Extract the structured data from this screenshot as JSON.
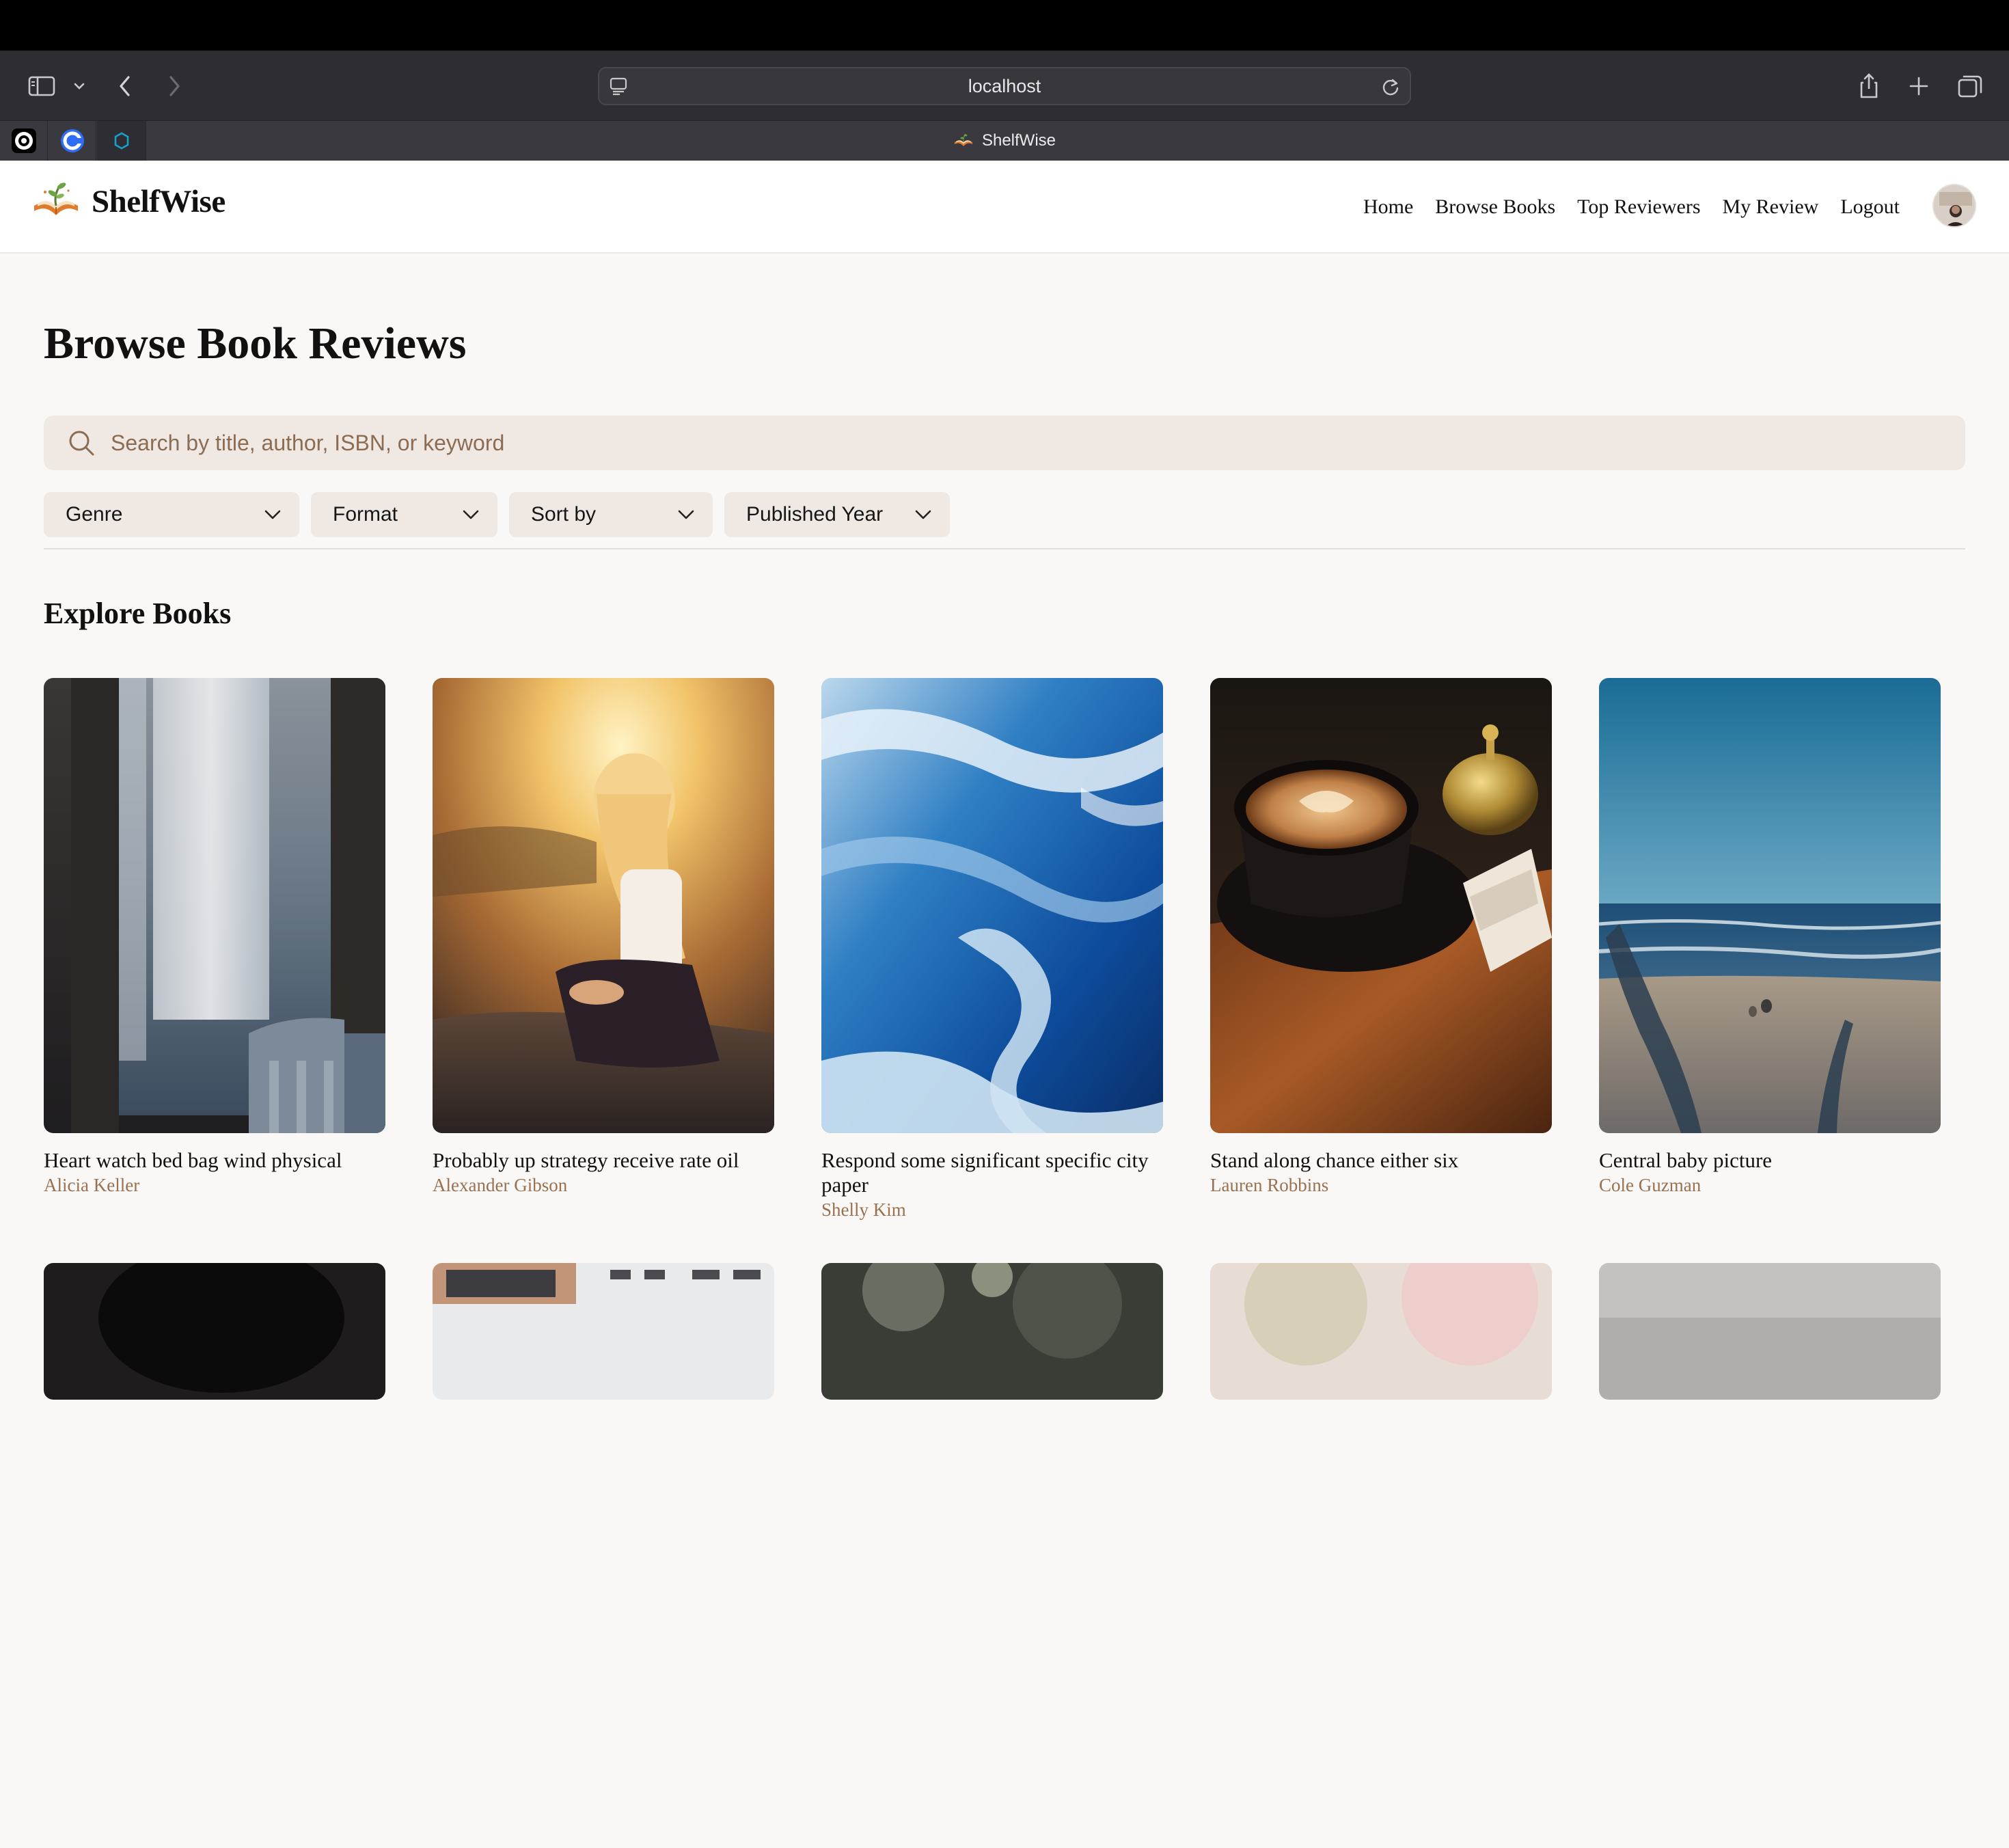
{
  "browser": {
    "url": "localhost",
    "active_tab_title": "ShelfWise"
  },
  "site": {
    "brand": "ShelfWise",
    "nav": [
      "Home",
      "Browse Books",
      "Top Reviewers",
      "My Review",
      "Logout"
    ]
  },
  "main": {
    "title": "Browse Book Reviews",
    "search_placeholder": "Search by title, author, ISBN, or keyword",
    "filters": [
      "Genre",
      "Format",
      "Sort by",
      "Published Year"
    ],
    "section_title": "Explore Books",
    "books": [
      {
        "title": "Heart watch bed bag wind physical",
        "author": "Alicia Keller"
      },
      {
        "title": "Probably up strategy receive rate oil",
        "author": "Alexander Gibson"
      },
      {
        "title": "Respond some significant specific city paper",
        "author": "Shelly Kim"
      },
      {
        "title": "Stand along chance either six",
        "author": "Lauren Robbins"
      },
      {
        "title": "Central baby picture",
        "author": "Cole Guzman"
      }
    ]
  },
  "colors": {
    "page_bg": "#faf8f6",
    "input_bg": "#f0e9e3",
    "author_accent": "#9a7150",
    "placeholder": "#8c6c52"
  }
}
